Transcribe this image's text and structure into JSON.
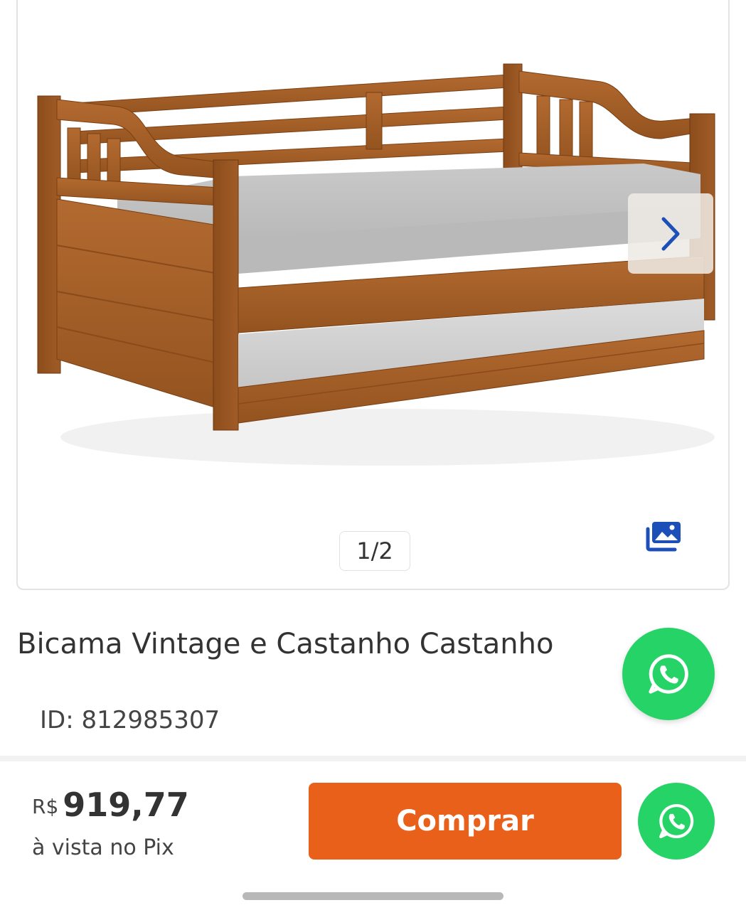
{
  "gallery": {
    "counter": "1/2",
    "image_subject": "bed-product-image",
    "next_icon": "chevron-right-icon",
    "gallery_icon": "image-gallery-icon"
  },
  "product": {
    "title": "Bicama Vintage e Castanho Castanho",
    "id_text": "ID: 812985307"
  },
  "purchase": {
    "currency": "R$",
    "price": "919,77",
    "price_note": "à vista no Pix",
    "buy_label": "Comprar"
  },
  "icons": {
    "whatsapp": "whatsapp-icon"
  },
  "colors": {
    "accent_orange": "#e8601a",
    "whatsapp_green": "#25d366",
    "wood": "#a8612a",
    "chevron_blue": "#1d4fb8"
  }
}
